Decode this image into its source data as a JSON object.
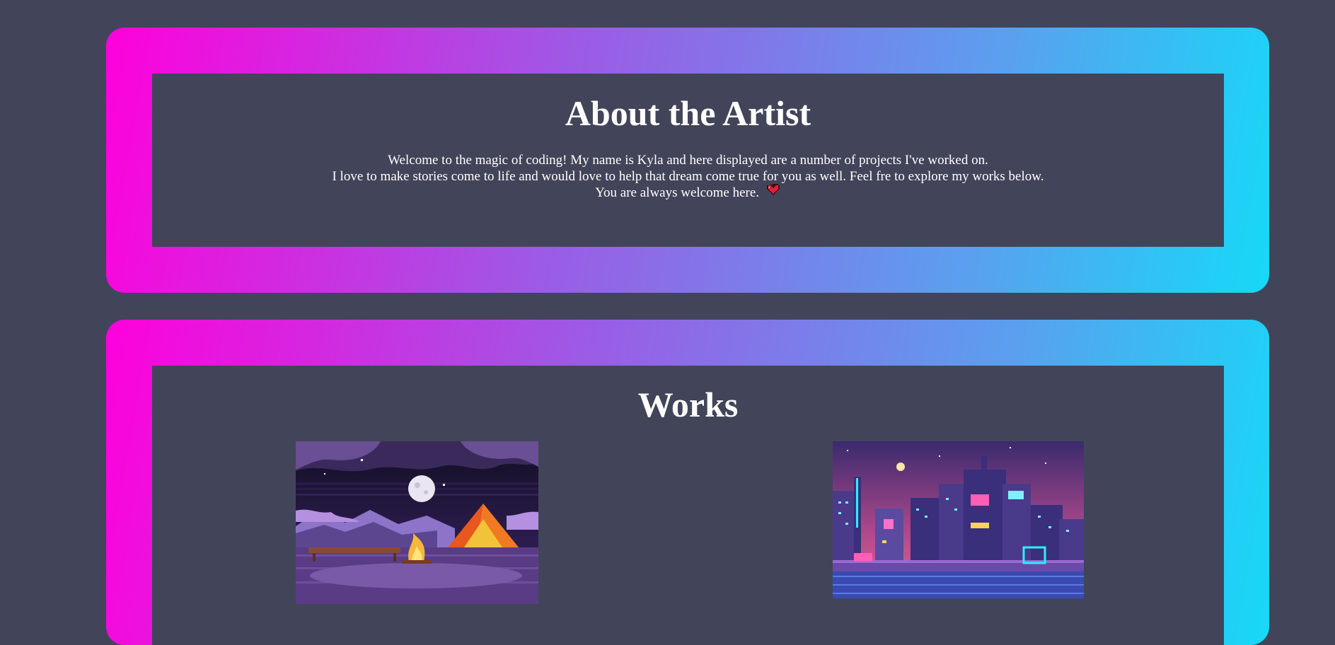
{
  "about": {
    "title": "About the Artist",
    "lines": [
      "Welcome to the magic of coding! My name is Kyla and here displayed are a number of projects I've worked on.",
      "I love to make stories come to life and would love to help that dream come true for you as well. Feel fre to explore my works below.",
      "You are always welcome here."
    ],
    "heart_icon": "pixel-heart-icon"
  },
  "works": {
    "title": "Works",
    "items": [
      {
        "name": "campfire-night-pixel-art",
        "icon": "campfire-tent-thumbnail"
      },
      {
        "name": "neon-city-pixel-art",
        "icon": "neon-city-thumbnail"
      }
    ]
  },
  "colors": {
    "background": "#424559",
    "gradient_start": "#ff00dc",
    "gradient_end": "#16d9f7",
    "text": "#ffffff"
  }
}
